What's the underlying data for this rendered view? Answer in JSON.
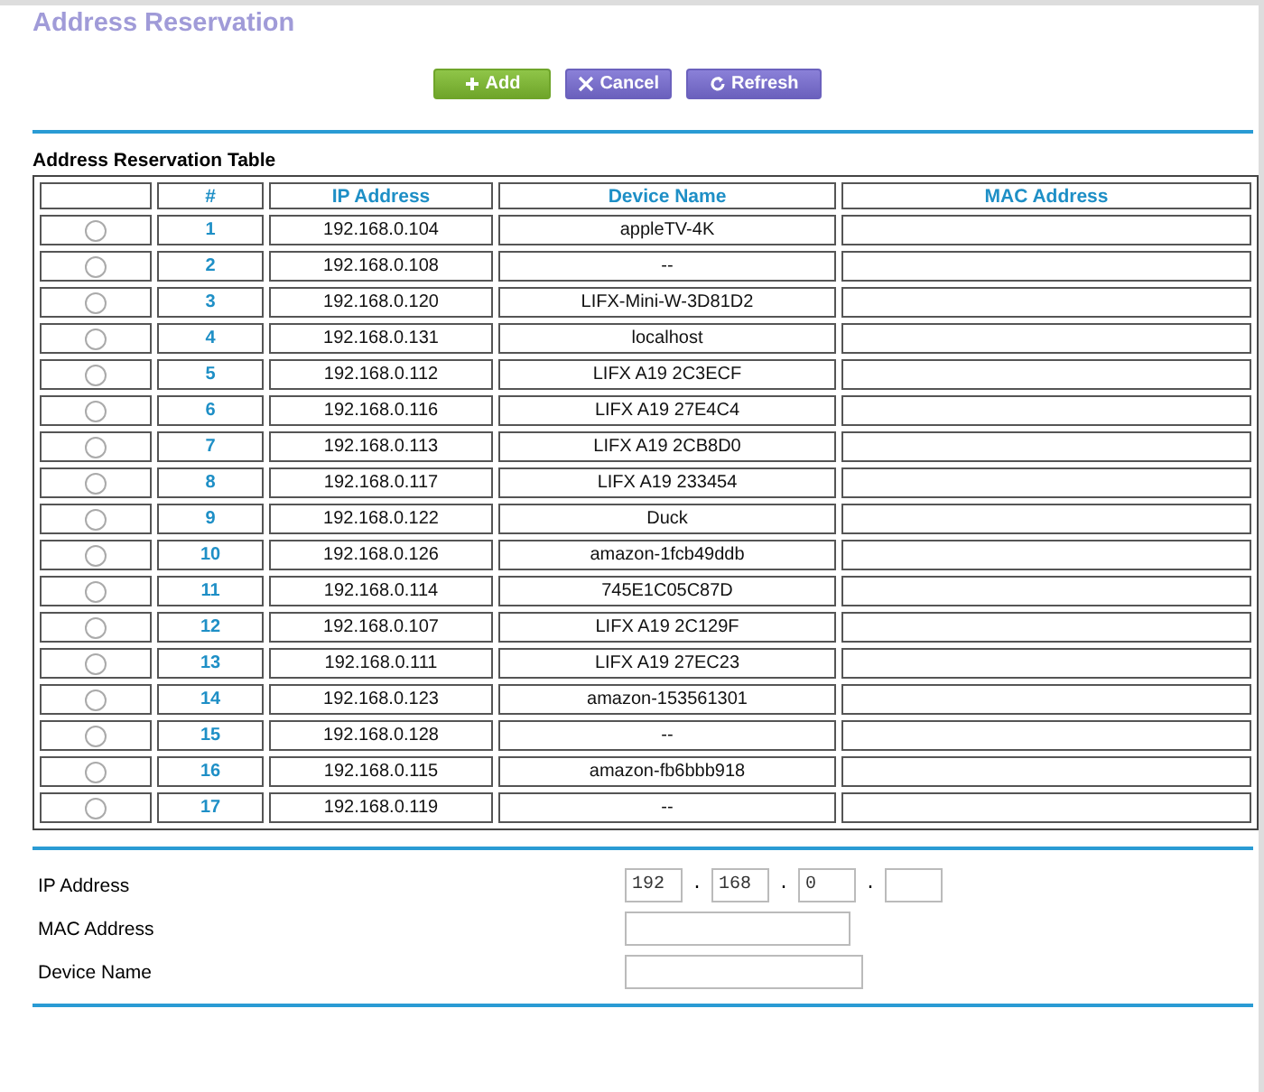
{
  "title": "Address Reservation",
  "buttons": [
    {
      "kind": "add",
      "label": "Add"
    },
    {
      "kind": "cancel",
      "label": "Cancel"
    },
    {
      "kind": "refresh",
      "label": "Refresh"
    }
  ],
  "table": {
    "caption": "Address Reservation Table",
    "columns": [
      "#",
      "IP Address",
      "Device Name",
      "MAC Address"
    ],
    "rows": [
      {
        "selected": false,
        "number": "1",
        "ip": "192.168.0.104",
        "device": "appleTV-4K"
      },
      {
        "selected": false,
        "number": "2",
        "ip": "192.168.0.108",
        "device": "--"
      },
      {
        "selected": false,
        "number": "3",
        "ip": "192.168.0.120",
        "device": "LIFX-Mini-W-3D81D2"
      },
      {
        "selected": false,
        "number": "4",
        "ip": "192.168.0.131",
        "device": "localhost"
      },
      {
        "selected": false,
        "number": "5",
        "ip": "192.168.0.112",
        "device": "LIFX A19 2C3ECF"
      },
      {
        "selected": false,
        "number": "6",
        "ip": "192.168.0.116",
        "device": "LIFX A19 27E4C4"
      },
      {
        "selected": false,
        "number": "7",
        "ip": "192.168.0.113",
        "device": "LIFX A19 2CB8D0"
      },
      {
        "selected": false,
        "number": "8",
        "ip": "192.168.0.117",
        "device": "LIFX A19 233454"
      },
      {
        "selected": false,
        "number": "9",
        "ip": "192.168.0.122",
        "device": "Duck"
      },
      {
        "selected": false,
        "number": "10",
        "ip": "192.168.0.126",
        "device": "amazon-1fcb49ddb"
      },
      {
        "selected": false,
        "number": "11",
        "ip": "192.168.0.114",
        "device": "745E1C05C87D"
      },
      {
        "selected": false,
        "number": "12",
        "ip": "192.168.0.107",
        "device": "LIFX A19 2C129F"
      },
      {
        "selected": false,
        "number": "13",
        "ip": "192.168.0.111",
        "device": "LIFX A19 27EC23"
      },
      {
        "selected": false,
        "number": "14",
        "ip": "192.168.0.123",
        "device": "amazon-153561301"
      },
      {
        "selected": false,
        "number": "15",
        "ip": "192.168.0.128",
        "device": "--"
      },
      {
        "selected": false,
        "number": "16",
        "ip": "192.168.0.115",
        "device": "amazon-fb6bbb918"
      },
      {
        "selected": false,
        "number": "17",
        "ip": "192.168.0.119",
        "device": "--"
      }
    ]
  },
  "form": {
    "ip_label": "IP Address",
    "ip_octets": [
      "192",
      "168",
      "0"
    ],
    "separator": ".",
    "mac_label": "MAC Address",
    "device_label": "Device Name"
  }
}
